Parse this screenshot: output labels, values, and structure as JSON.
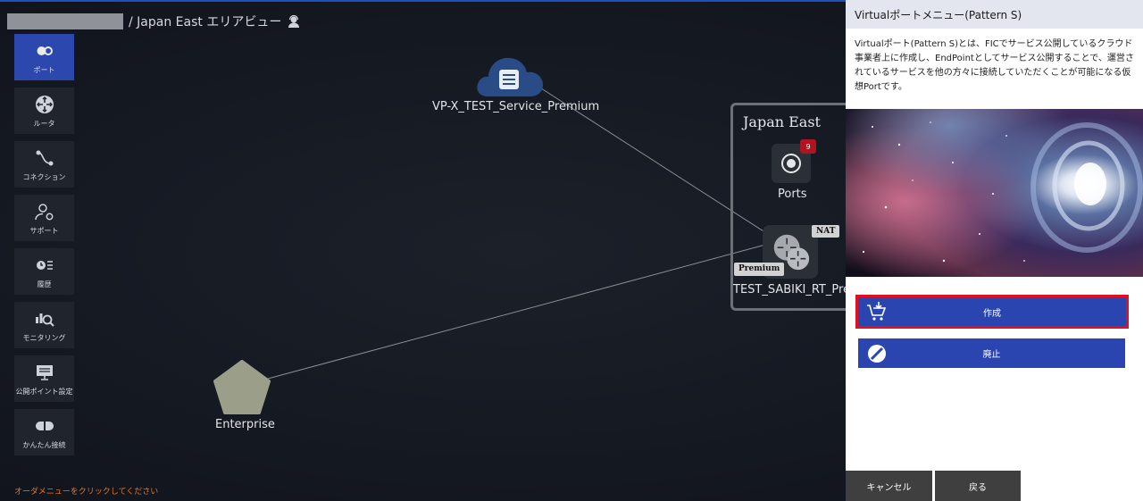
{
  "breadcrumb": {
    "area_label": "/ Japan East エリアビュー",
    "user_icon": "user-headset-icon"
  },
  "sidebar": {
    "items": [
      {
        "label": "ポート",
        "icon": "port-icon",
        "active": true
      },
      {
        "label": "ルータ",
        "icon": "router-icon",
        "active": false
      },
      {
        "label": "コネクション",
        "icon": "connection-icon",
        "active": false
      },
      {
        "label": "サポート",
        "icon": "support-icon",
        "active": false
      },
      {
        "label": "履歴",
        "icon": "history-icon",
        "active": false
      },
      {
        "label": "モニタリング",
        "icon": "monitoring-icon",
        "active": false
      },
      {
        "label": "公開ポイント設定",
        "icon": "monitor-icon",
        "active": false
      },
      {
        "label": "かんたん接続",
        "icon": "plug-icon",
        "active": false
      }
    ]
  },
  "order_hint": "オーダメニューをクリックしてください",
  "canvas": {
    "cloud_node": {
      "label": "VP-X_TEST_Service_Premium",
      "icon": "server-cloud-icon"
    },
    "enterprise_node": {
      "label": "Enterprise",
      "icon": "pentagon-icon"
    },
    "area": {
      "title": "Japan East",
      "ports": {
        "label": "Ports",
        "badge": "9",
        "icon": "radio-port-icon"
      },
      "router": {
        "label": "TEST_SABIKI_RT_Pre",
        "nat_tag": "NAT",
        "premium_tag": "Premium",
        "icon": "router-icon"
      }
    }
  },
  "panel": {
    "title": "Virtualポートメニュー(Pattern S)",
    "description": "Virtualポート(Pattern S)とは、FICでサービス公開しているクラウド事業者上に作成し、EndPointとしてサービス公開することで、運営されているサービスを他の方々に接続していただくことが可能になる仮想Portです。",
    "create_label": "作成",
    "create_icon": "cart-add-icon",
    "delete_label": "廃止",
    "delete_icon": "ban-icon",
    "cancel_label": "キャンセル",
    "back_label": "戻る"
  },
  "colors": {
    "accent": "#2a45b0",
    "active_sidebar": "#2c47ad",
    "highlight": "#e0101f",
    "hint": "#e0762d"
  }
}
